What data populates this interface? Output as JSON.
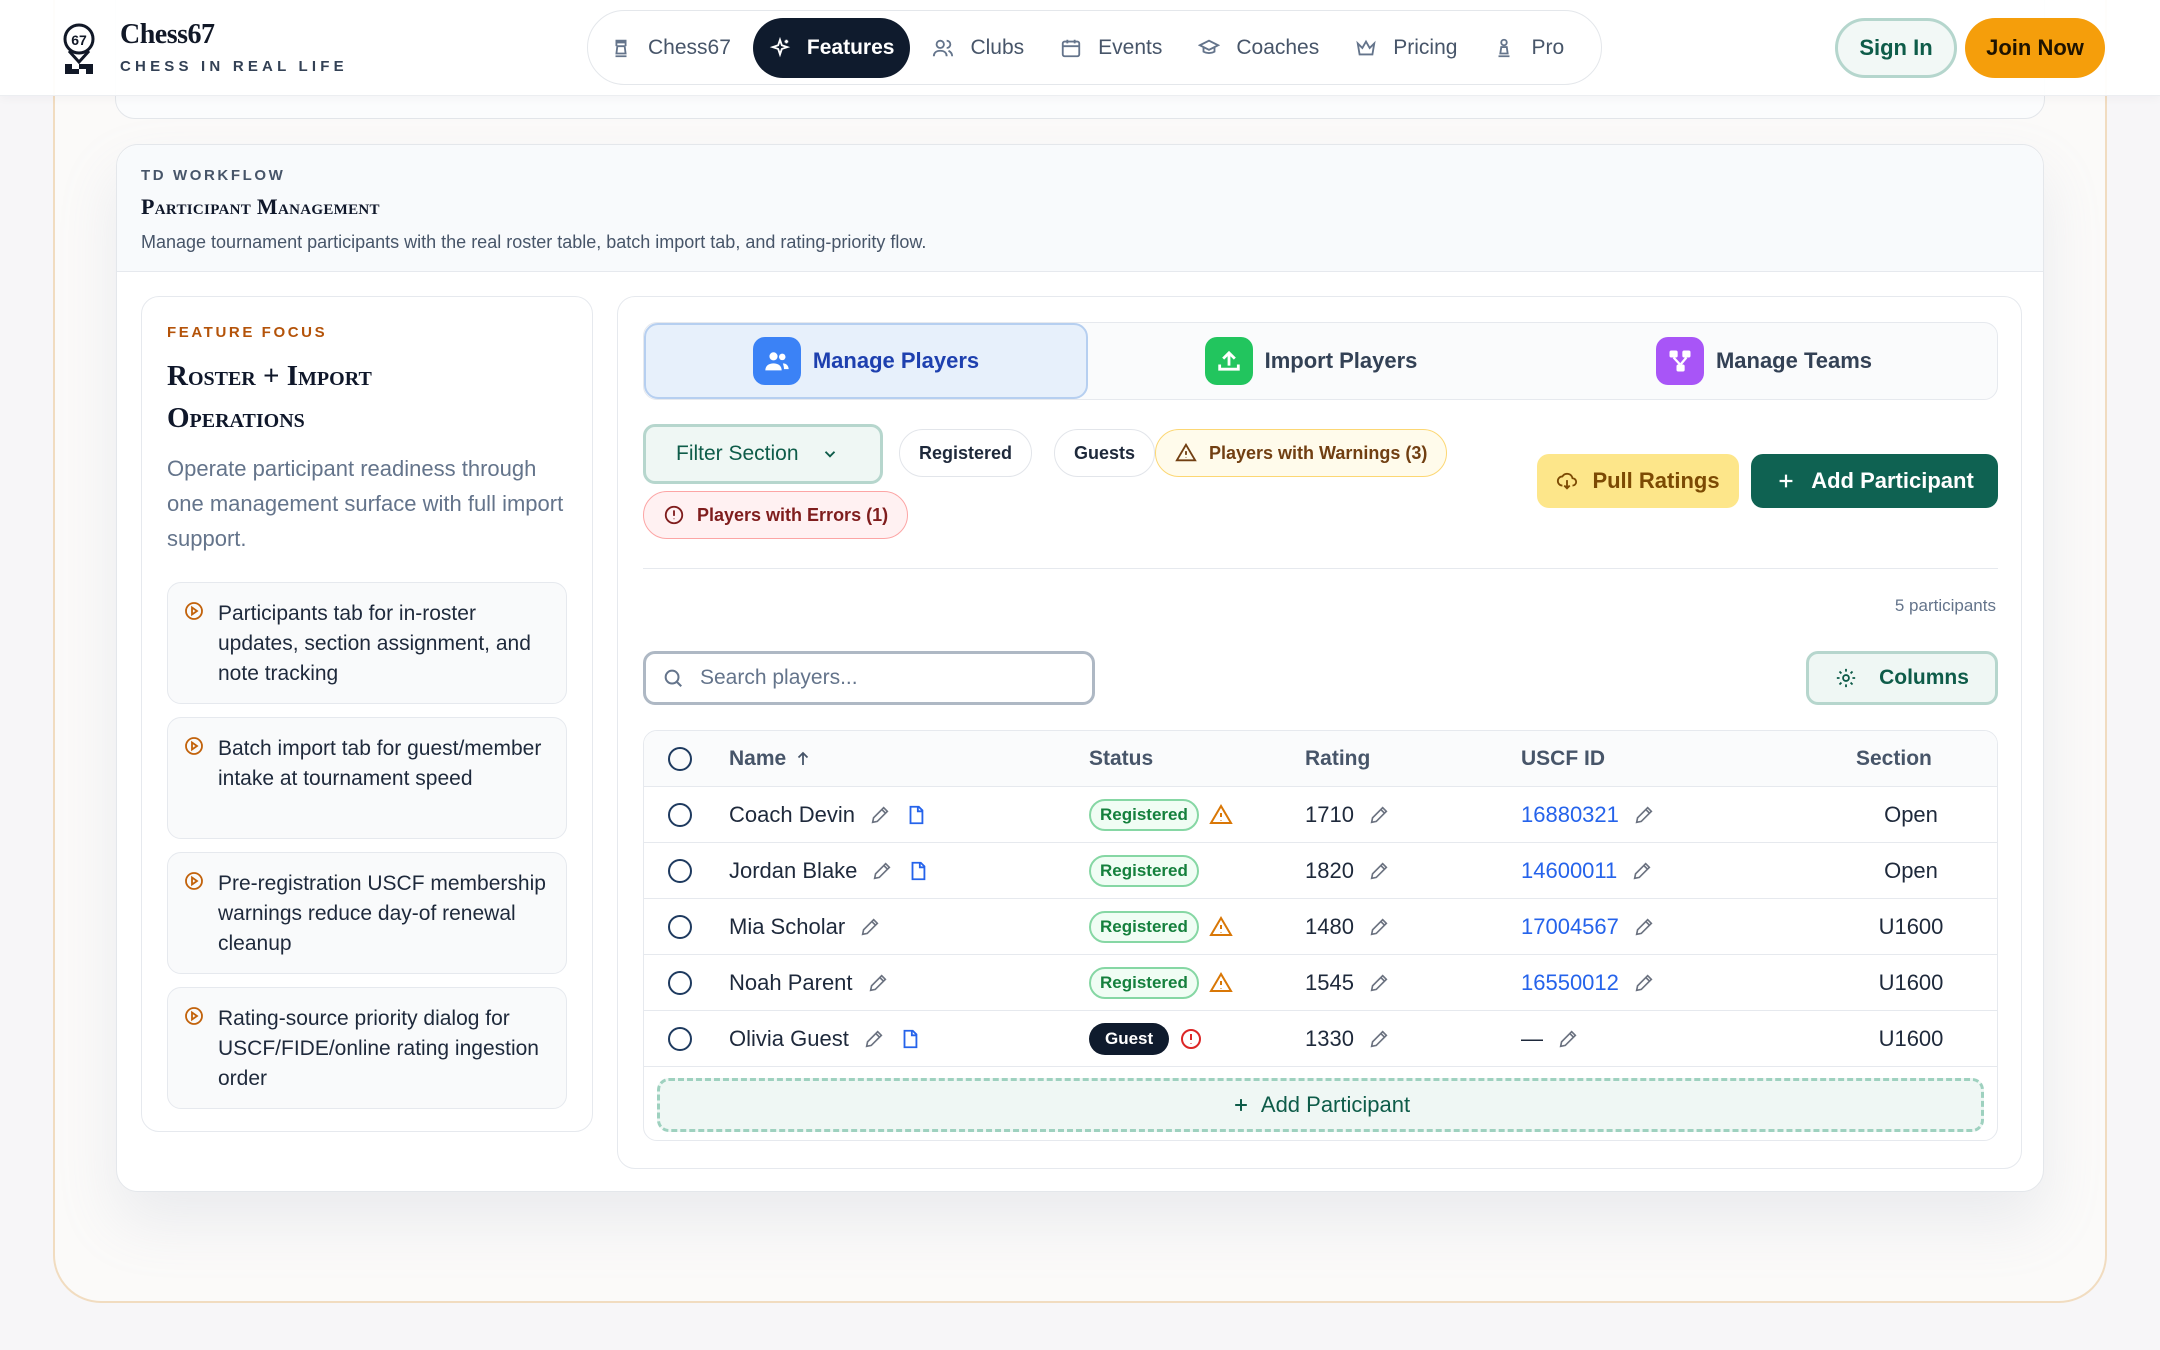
{
  "brand": {
    "name": "Chess67",
    "tagline": "CHESS IN REAL LIFE"
  },
  "nav": {
    "items": [
      {
        "label": "Chess67",
        "icon": "rook-icon",
        "active": false
      },
      {
        "label": "Features",
        "icon": "sparkles-icon",
        "active": true
      },
      {
        "label": "Clubs",
        "icon": "users-icon",
        "active": false
      },
      {
        "label": "Events",
        "icon": "calendar-icon",
        "active": false
      },
      {
        "label": "Coaches",
        "icon": "graduation-cap-icon",
        "active": false
      },
      {
        "label": "Pricing",
        "icon": "crown-icon",
        "active": false
      },
      {
        "label": "Pro",
        "icon": "pawn-icon",
        "active": false
      }
    ],
    "sign_in": "Sign In",
    "join_now": "Join Now"
  },
  "section": {
    "eyebrow": "TD WORKFLOW",
    "title": "Participant Management",
    "description": "Manage tournament participants with the real roster table, batch import tab, and rating-priority flow."
  },
  "focus": {
    "eyebrow": "FEATURE FOCUS",
    "title_line1": "Roster + Import",
    "title_line2": "Operations",
    "description": "Operate participant readiness through one management surface with full import support.",
    "bullets": [
      "Participants tab for in-roster updates, section assignment, and note tracking",
      "Batch import tab for guest/member intake at tournament speed",
      "Pre-registration USCF membership warnings reduce day-of renewal cleanup",
      "Rating-source priority dialog for USCF/FIDE/online rating ingestion order"
    ]
  },
  "tabs": [
    {
      "label": "Manage Players",
      "icon": "users-icon",
      "color": "#3b82f6",
      "active": true
    },
    {
      "label": "Import Players",
      "icon": "upload-icon",
      "color": "#22c55e",
      "active": false
    },
    {
      "label": "Manage Teams",
      "icon": "network-icon",
      "color": "#a855f7",
      "active": false
    }
  ],
  "toolbar": {
    "filter_label": "Filter Section",
    "chips": {
      "registered": "Registered",
      "guests": "Guests",
      "warnings": "Players with Warnings (3)",
      "errors": "Players with Errors (1)"
    },
    "pull_ratings": "Pull Ratings",
    "add_participant": "Add Participant"
  },
  "participants_count": "5 participants",
  "search": {
    "placeholder": "Search players..."
  },
  "columns_label": "Columns",
  "table": {
    "headers": {
      "name": "Name",
      "status": "Status",
      "rating": "Rating",
      "uscf": "USCF ID",
      "section": "Section"
    },
    "rows": [
      {
        "name": "Coach Devin",
        "has_doc": true,
        "status": "Registered",
        "alert": "warning",
        "rating": "1710",
        "uscf": "16880321",
        "section": "Open"
      },
      {
        "name": "Jordan Blake",
        "has_doc": true,
        "status": "Registered",
        "alert": "none",
        "rating": "1820",
        "uscf": "14600011",
        "section": "Open"
      },
      {
        "name": "Mia Scholar",
        "has_doc": false,
        "status": "Registered",
        "alert": "warning",
        "rating": "1480",
        "uscf": "17004567",
        "section": "U1600"
      },
      {
        "name": "Noah Parent",
        "has_doc": false,
        "status": "Registered",
        "alert": "warning",
        "rating": "1545",
        "uscf": "16550012",
        "section": "U1600"
      },
      {
        "name": "Olivia Guest",
        "has_doc": true,
        "status": "Guest",
        "alert": "error",
        "rating": "1330",
        "uscf": "—",
        "section": "U1600"
      }
    ],
    "add_row_label": "Add Participant"
  },
  "colors": {
    "brand_dark": "#0f1b2d",
    "accent_orange": "#f59e0b",
    "accent_green": "#0f6252",
    "link_blue": "#2563eb"
  }
}
